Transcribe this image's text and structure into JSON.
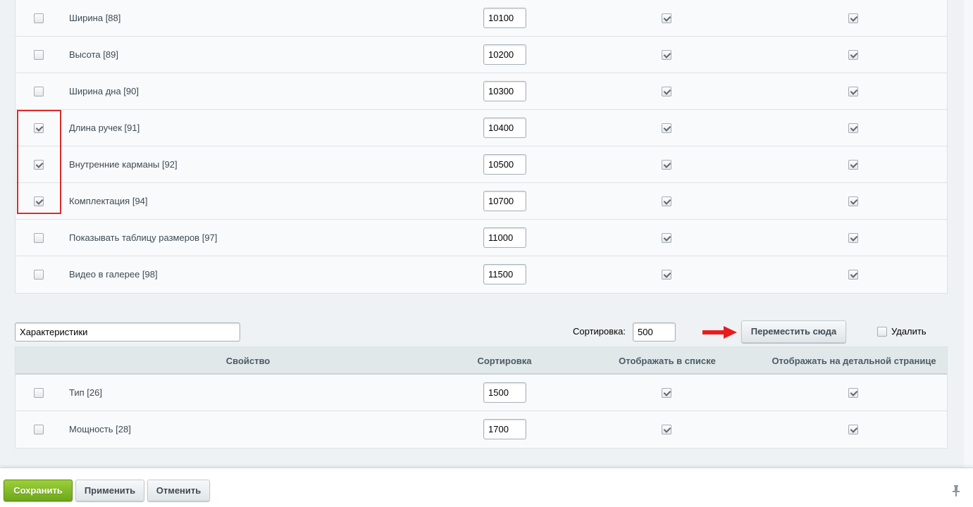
{
  "top_table": {
    "rows": [
      {
        "name": "Ширина [88]",
        "sort": "10100",
        "selected": false,
        "in_list": true,
        "in_detail": true
      },
      {
        "name": "Высота [89]",
        "sort": "10200",
        "selected": false,
        "in_list": true,
        "in_detail": true
      },
      {
        "name": "Ширина дна [90]",
        "sort": "10300",
        "selected": false,
        "in_list": true,
        "in_detail": true
      },
      {
        "name": "Длина ручек [91]",
        "sort": "10400",
        "selected": true,
        "in_list": true,
        "in_detail": true
      },
      {
        "name": "Внутренние карманы [92]",
        "sort": "10500",
        "selected": true,
        "in_list": true,
        "in_detail": true
      },
      {
        "name": "Комплектация [94]",
        "sort": "10700",
        "selected": true,
        "in_list": true,
        "in_detail": true
      },
      {
        "name": "Показывать таблицу размеров [97]",
        "sort": "11000",
        "selected": false,
        "in_list": true,
        "in_detail": true
      },
      {
        "name": "Видео в галерее [98]",
        "sort": "11500",
        "selected": false,
        "in_list": true,
        "in_detail": true
      }
    ]
  },
  "section": {
    "name": "Характеристики",
    "sort_label": "Сортировка:",
    "sort_value": "500",
    "move_button": "Переместить сюда",
    "delete_label": "Удалить",
    "delete_checked": false
  },
  "bottom_table": {
    "headers": {
      "property": "Свойство",
      "sort": "Сортировка",
      "in_list": "Отображать в списке",
      "in_detail": "Отображать на детальной странице"
    },
    "rows": [
      {
        "name": "Тип [26]",
        "sort": "1500",
        "selected": false,
        "in_list": true,
        "in_detail": true
      },
      {
        "name": "Мощность [28]",
        "sort": "1700",
        "selected": false,
        "in_list": true,
        "in_detail": true
      }
    ]
  },
  "footer": {
    "save": "Сохранить",
    "apply": "Применить",
    "cancel": "Отменить"
  },
  "colors": {
    "save_button": "#7ab527",
    "highlight_box": "#e02b2b",
    "arrow": "#e81c1c"
  }
}
